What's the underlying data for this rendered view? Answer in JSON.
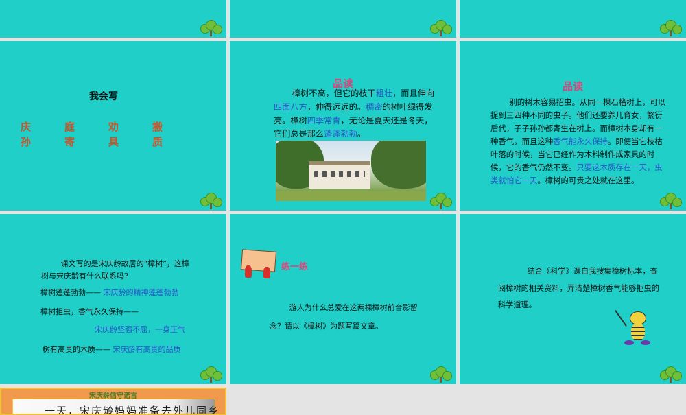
{
  "slide4": {
    "title": "我会写",
    "row1": [
      "庆",
      "庭",
      "劝",
      "搬"
    ],
    "row2": [
      "孙",
      "寄",
      "具",
      "质"
    ]
  },
  "slide5": {
    "title": "品读",
    "segs": [
      "樟树不高，但它的枝干",
      "粗壮",
      "，而且伸向",
      "四面八方",
      "，伸得远远的。",
      "稠密",
      "的树叶绿得发亮。樟树",
      "四季常青",
      "，无论是夏天还是冬天，它们总是那么",
      "蓬蓬勃勃",
      "。"
    ]
  },
  "slide6": {
    "title": "品读",
    "segs": [
      "别的树木容易招虫。从同一棵石榴树上，可以捉到三四种不同的虫子。他们还要养儿育女，繁衍后代，子子孙孙都寄生在树上。而樟树本身却有一种香气，而且这种",
      "香气能永久保持",
      "。即使当它枝枯叶落的时候，当它已经作为木料制作成家具的时候，它的香气仍然不变。",
      "只要这木质存在一天，虫类就怕它一天",
      "。樟树的可贵之处就在这里。"
    ]
  },
  "slide7": {
    "q": "课文写的是宋庆龄故居的“樟树”，这樟树与宋庆龄有什么联系吗?",
    "l1a": "樟树蓬蓬勃勃——",
    "l1b": "宋庆龄的精神蓬蓬勃勃",
    "l2a": "樟树拒虫，香气永久保持——",
    "l2b": "宋庆龄坚强不屈，一身正气",
    "l3a": "树有高贵的木质——",
    "l3b": "宋庆龄有高贵的品质"
  },
  "slide8": {
    "title": "练一练",
    "text": "游人为什么总爱在这两棵樟树前合影留念？请以《樟树》为题写篇文章。"
  },
  "slide9": {
    "text": "结合《科学》课自我搜集樟树标本，查阅樟树的相关资料，弄清楚樟树香气能够拒虫的科学道理。"
  },
  "slide10": {
    "title": "宋庆龄信守诺言",
    "text": "一天，宋庆龄妈妈准备去外儿同乡"
  }
}
